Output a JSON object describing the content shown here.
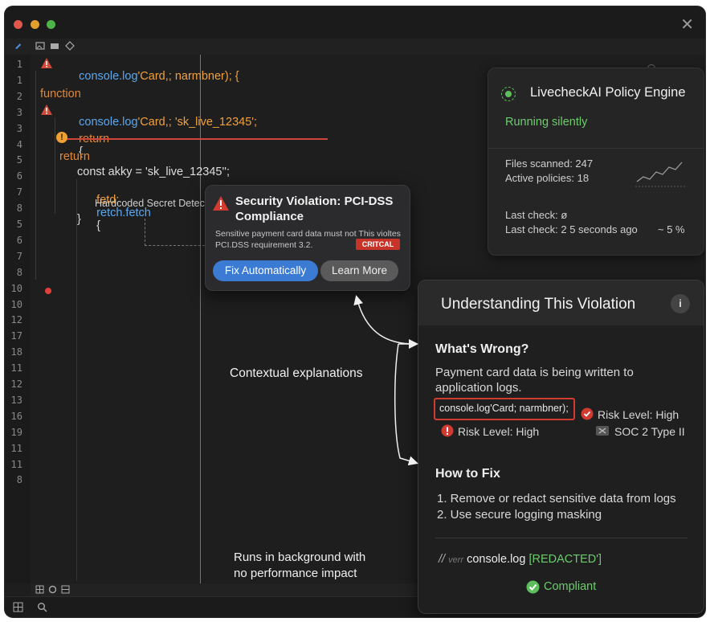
{
  "editor": {
    "gutter_lines": [
      "1",
      "1",
      "2",
      "3",
      "3",
      "4",
      "5",
      "6",
      "7",
      "8",
      "5",
      "6",
      "7",
      "8",
      "10",
      "10",
      "12",
      "17",
      "18",
      "11",
      "12",
      "13",
      "16",
      "19",
      "11",
      "11",
      "8"
    ],
    "code": {
      "l0_fn": "console.log",
      "l0_rest": "'Card,; narmbner); {",
      "l1_kw": "function",
      "l2_fn": "console.log",
      "l2_rest": "'Card,; 'sk_live_12345';",
      "l3_kw": "return",
      "l3_rest": "{",
      "l5_kw": "return",
      "l6_text": "const akky = 'sk_live_12345'';",
      "l7_fn1": "fetd:",
      "l7_fn2": "retch.fetch",
      "l7_rest": "{",
      "l8_text": "Hardcoded Secret Detec",
      "l9_text": "}"
    }
  },
  "popup": {
    "title": "Security Violation: PCI-DSS Compliance",
    "body": "Sensitive payment card data must not This violtes PCI.DSS requirement 3.2.",
    "badge": "CRITCAL",
    "fix_button": "Fix Automatically",
    "learn_button": "Learn More"
  },
  "engine": {
    "title": "LivecheckAI Policy Engine",
    "status": "Running silently",
    "files_scanned": "Files scanned: 247",
    "active_policies": "Active policies: 18",
    "last_check_1": "Last check: ø",
    "last_check_2": "Last check: 2 5 seconds ago",
    "percent": "~ 5 %"
  },
  "explain": {
    "title": "Understanding This Violation",
    "whats_wrong_heading": "What's Wrong?",
    "whats_wrong_text_1": "Payment card data is being written to",
    "whats_wrong_text_2": "application logs.",
    "code_snippet": "console.log'Card; narmbner);",
    "risk_level_right": "Risk Level: High",
    "risk_level_left": "Risk Level: High",
    "soc": "SOC 2 Type II",
    "how_to_fix_heading": "How to Fix",
    "step1": "1. Remove or redact sensitive data from logs",
    "step2": "2. Use secure logging masking",
    "fixed_prefix": "//",
    "fixed_mid": "verr",
    "fixed_fn": "console.log",
    "fixed_redacted": "[REDACTED']",
    "compliant": "Compliant"
  },
  "annotations": {
    "contextual": "Contextual explanations",
    "runs_1": "Runs in background with",
    "runs_2": "no performance impact"
  },
  "colors": {
    "accent_blue": "#3b7bd4",
    "critical_red": "#d03a30",
    "success_green": "#5cbf5c",
    "warning_orange": "#e0883a"
  }
}
